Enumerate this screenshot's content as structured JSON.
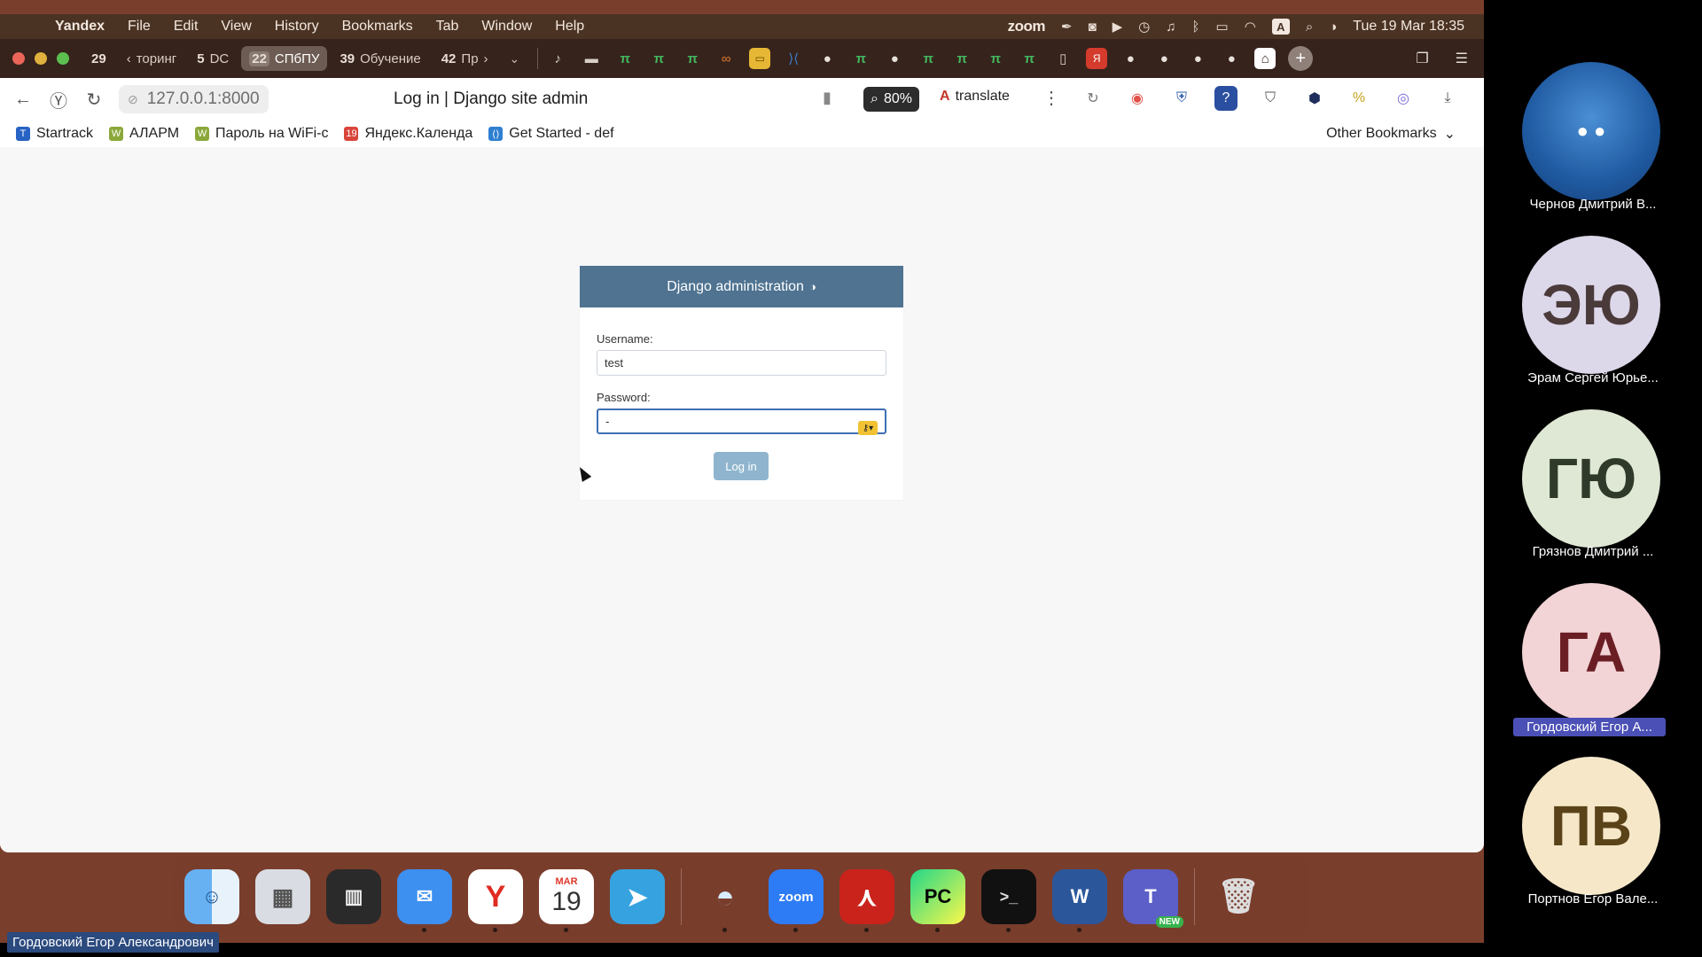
{
  "menubar": {
    "app_name": "Yandex",
    "menus": [
      "File",
      "Edit",
      "View",
      "History",
      "Bookmarks",
      "Tab",
      "Window",
      "Help"
    ],
    "zoom_label": "zoom",
    "input_indicator": "A",
    "datetime": "Tue 19 Mar  18:35"
  },
  "tabs": {
    "groups": [
      {
        "count": "29",
        "label": ""
      },
      {
        "count": "",
        "label": "торинг"
      },
      {
        "count": "5",
        "label": "DC"
      },
      {
        "count": "22",
        "label": "СПбПУ"
      },
      {
        "count": "39",
        "label": "Обучение"
      },
      {
        "count": "42",
        "label": "Пр"
      }
    ]
  },
  "addressbar": {
    "url": "127.0.0.1:8000",
    "page_title": "Log in | Django site admin",
    "zoom_level": "80%",
    "translate_label": "translate"
  },
  "bookmarks": {
    "items": [
      "Startrack",
      "АЛАРМ",
      "Пароль на WiFi-с",
      "Яндекс.Календа",
      "Get Started - def"
    ],
    "other": "Other Bookmarks"
  },
  "login": {
    "header": "Django administration",
    "username_label": "Username:",
    "username_value": "test",
    "password_label": "Password:",
    "password_value": "-",
    "button_label": "Log in"
  },
  "dock": {
    "calendar_month": "MAR",
    "calendar_day": "19",
    "zoom_label": "zoom",
    "pycharm_label": "PC",
    "word_label": "W",
    "teams_badge": "NEW"
  },
  "presenter": "Гордовский Егор Александрович",
  "participants": [
    {
      "name": "Чернов Дмитрий В...",
      "initials": "",
      "bg": "#2a6fb3"
    },
    {
      "name": "Эрам Сергей Юрье...",
      "initials": "ЭЮ",
      "bg": "#ddd7ea"
    },
    {
      "name": "Грязнов Дмитрий ...",
      "initials": "ГЮ",
      "bg": "#dfe8d4"
    },
    {
      "name": "Гордовский Егор А...",
      "initials": "ГА",
      "bg": "#f2d3d6"
    },
    {
      "name": "Портнов Егор Вале...",
      "initials": "ПВ",
      "bg": "#f6e7c9"
    }
  ]
}
